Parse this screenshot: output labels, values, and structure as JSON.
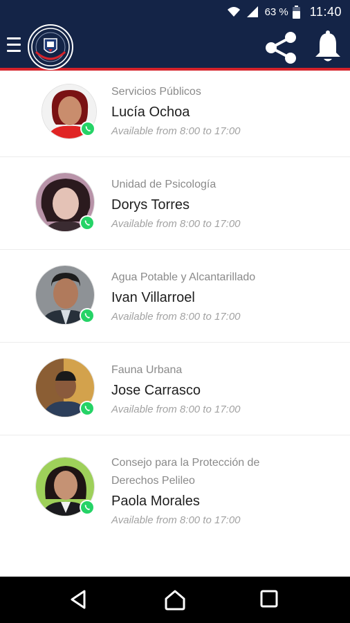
{
  "status_bar": {
    "battery": "63 %",
    "time": "11:40",
    "icons": [
      "wifi-icon",
      "signal-icon",
      "battery-icon"
    ]
  },
  "app_bar": {
    "icons": [
      "menu-icon",
      "app-logo",
      "share-icon",
      "bell-icon"
    ],
    "colors": {
      "background": "#142447",
      "accent_line": "#d6232b"
    }
  },
  "contacts": [
    {
      "department": "Servicios Públicos",
      "name": "Lucía Ochoa",
      "availability": "Available from 8:00 to 17:00"
    },
    {
      "department": "Unidad de Psicología",
      "name": "Dorys Torres",
      "availability": "Available from 8:00 to 17:00"
    },
    {
      "department": "Agua Potable y Alcantarillado",
      "name": "Ivan Villarroel",
      "availability": "Available from 8:00 to 17:00"
    },
    {
      "department": "Fauna Urbana",
      "name": "Jose Carrasco",
      "availability": "Available from 8:00 to 17:00"
    },
    {
      "department": "Consejo para la Protección de Derechos Pelileo",
      "name": "Paola Morales",
      "availability": "Available from 8:00 to 17:00"
    }
  ],
  "badge_icon": "whatsapp-icon",
  "badge_color": "#25d366",
  "nav_bar": {
    "icons": [
      "back-icon",
      "home-icon",
      "recents-icon"
    ]
  }
}
